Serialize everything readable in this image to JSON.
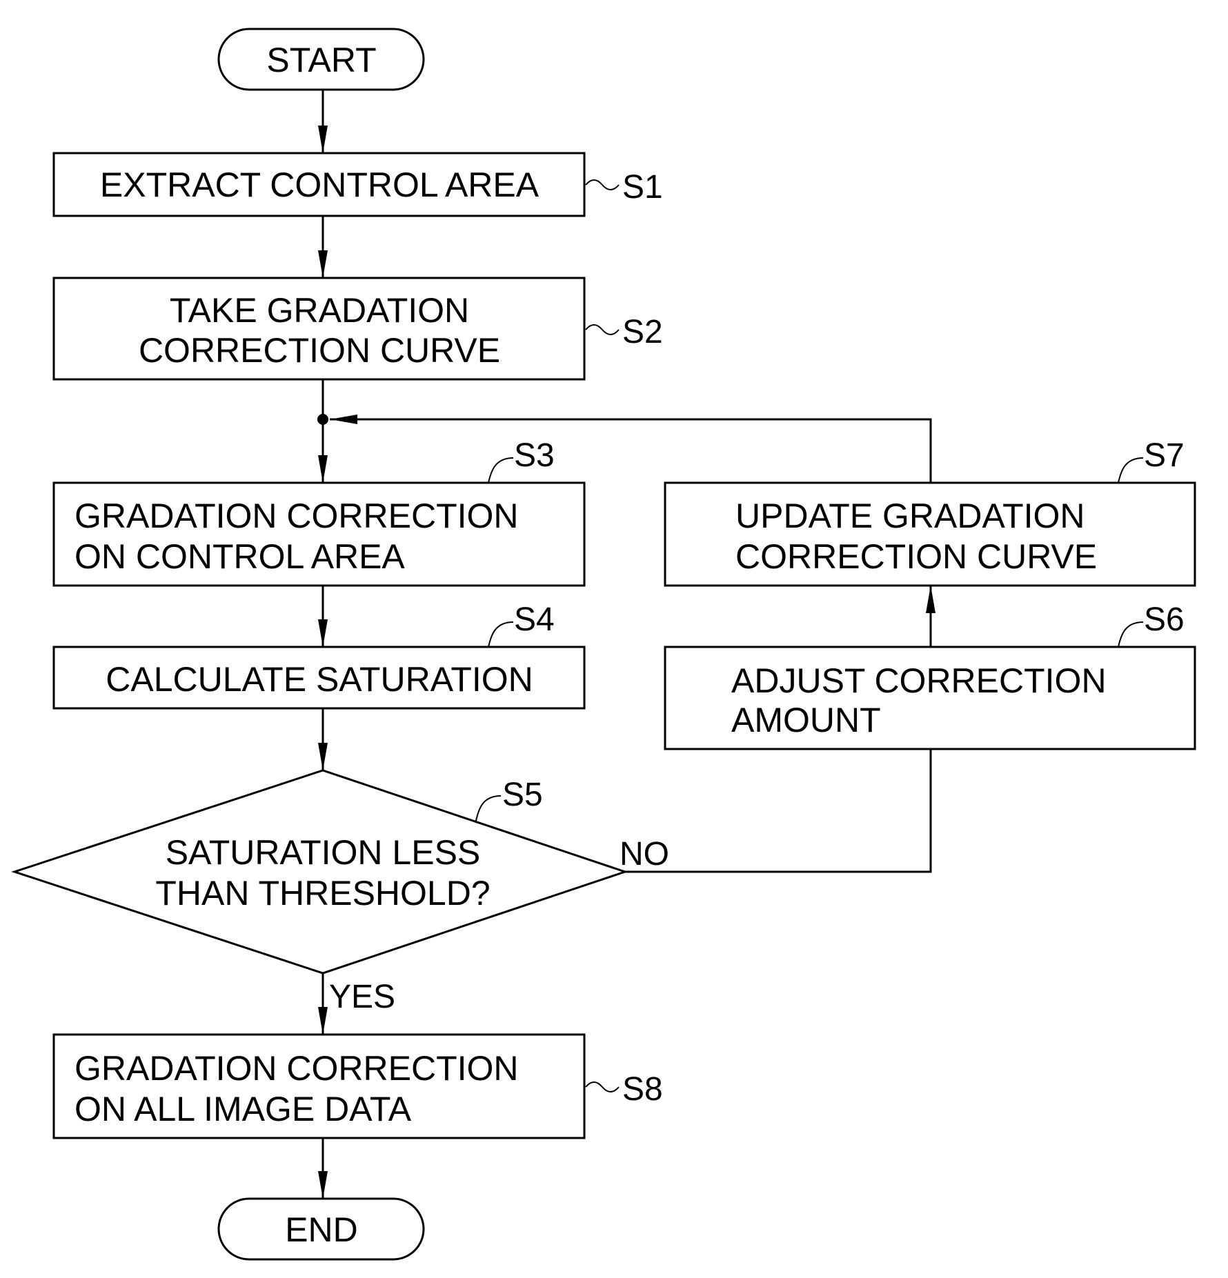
{
  "diagram": {
    "type": "flowchart",
    "start": {
      "label": "START"
    },
    "end": {
      "label": "END"
    },
    "steps": [
      {
        "id": "S1",
        "lines": [
          "EXTRACT CONTROL AREA"
        ]
      },
      {
        "id": "S2",
        "lines": [
          "TAKE GRADATION",
          "CORRECTION CURVE"
        ]
      },
      {
        "id": "S3",
        "lines": [
          "GRADATION CORRECTION",
          "ON CONTROL AREA"
        ]
      },
      {
        "id": "S4",
        "lines": [
          "CALCULATE SATURATION"
        ]
      },
      {
        "id": "S5",
        "lines": [
          "SATURATION LESS",
          "THAN THRESHOLD?"
        ],
        "kind": "decision"
      },
      {
        "id": "S6",
        "lines": [
          "ADJUST CORRECTION",
          "AMOUNT"
        ]
      },
      {
        "id": "S7",
        "lines": [
          "UPDATE GRADATION",
          "CORRECTION CURVE"
        ]
      },
      {
        "id": "S8",
        "lines": [
          "GRADATION CORRECTION",
          "ON ALL IMAGE DATA"
        ]
      }
    ],
    "branches": {
      "yes": "YES",
      "no": "NO"
    },
    "edges": [
      [
        "START",
        "S1"
      ],
      [
        "S1",
        "S2"
      ],
      [
        "S2",
        "S3"
      ],
      [
        "S3",
        "S4"
      ],
      [
        "S4",
        "S5"
      ],
      [
        "S5",
        "S8",
        "YES"
      ],
      [
        "S5",
        "S6",
        "NO"
      ],
      [
        "S6",
        "S7"
      ],
      [
        "S7",
        "S3"
      ],
      [
        "S8",
        "END"
      ]
    ]
  }
}
